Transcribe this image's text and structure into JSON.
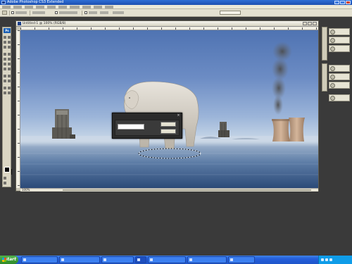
{
  "app": {
    "title": "Adobe Photoshop CS3 Extended"
  },
  "menubar": {
    "items": [
      "",
      "",
      "",
      "",
      "",
      "",
      "",
      "",
      "",
      ""
    ]
  },
  "options_bar": {
    "dropdown_value": ""
  },
  "document": {
    "title": "Untitled-1 @ 100% (RGB/8)",
    "zoom": "100%"
  },
  "dialog": {
    "title": "",
    "field_value": "",
    "unit_label": "",
    "ok_label": "",
    "cancel_label": ""
  },
  "panels": {
    "items": [
      "",
      "",
      "",
      "",
      "",
      "",
      ""
    ]
  },
  "taskbar": {
    "start_label": "start",
    "tasks": [
      "",
      "",
      "",
      "",
      "",
      "",
      ""
    ],
    "clock": ""
  },
  "colors": {
    "titlebar": "#1c4fb0",
    "taskbar": "#245edb",
    "start": "#2f8a2a",
    "dialog": "#2b2b2b"
  }
}
